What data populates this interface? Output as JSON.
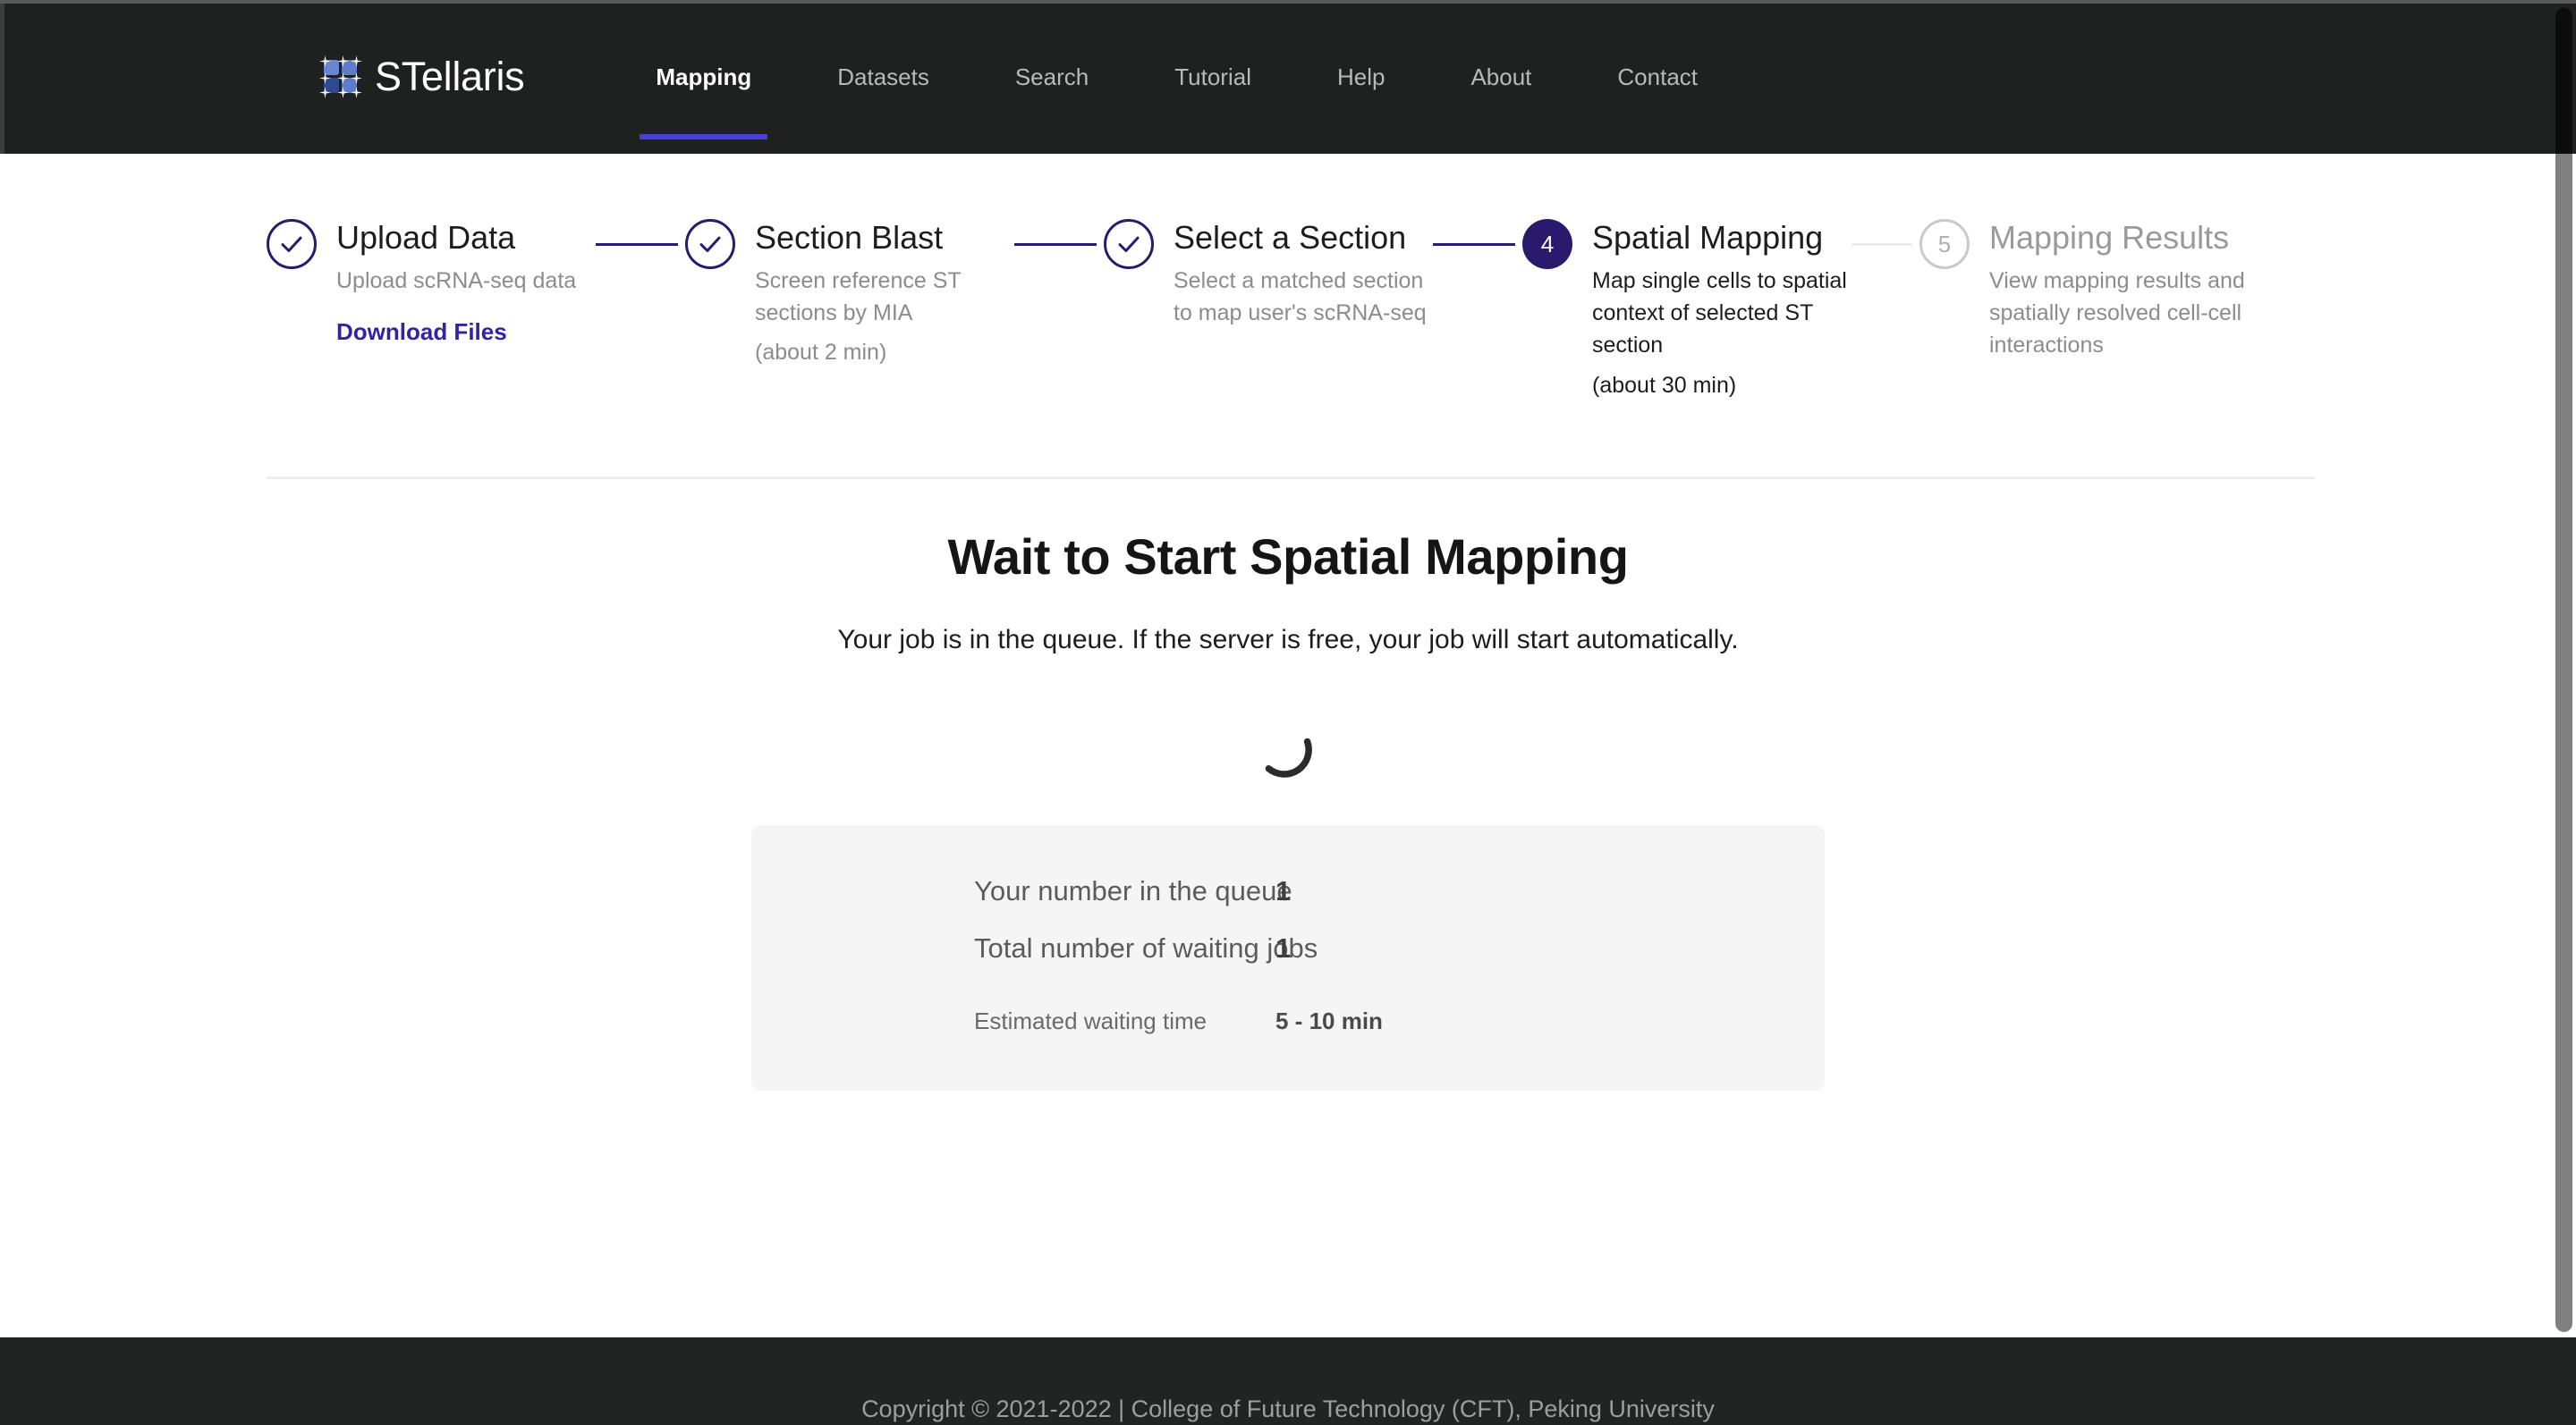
{
  "navbar": {
    "brand": "STellaris",
    "logo_icon": "stellaris-grid-logo-icon",
    "links": [
      {
        "label": "Mapping",
        "active": true
      },
      {
        "label": "Datasets",
        "active": false
      },
      {
        "label": "Search",
        "active": false
      },
      {
        "label": "Tutorial",
        "active": false
      },
      {
        "label": "Help",
        "active": false
      },
      {
        "label": "About",
        "active": false
      },
      {
        "label": "Contact",
        "active": false
      }
    ],
    "accent_underline_color": "#4a3fd8",
    "background_color": "#1f2020"
  },
  "stepper": {
    "accent_color": "#2a1a6e",
    "steps": [
      {
        "number": "1",
        "state": "done",
        "marker": "check-icon",
        "title": "Upload Data",
        "desc": "Upload scRNA-seq data",
        "time": "",
        "link": "Download Files"
      },
      {
        "number": "2",
        "state": "done",
        "marker": "check-icon",
        "title": "Section Blast",
        "desc": "Screen reference ST sections by MIA",
        "time": "(about 2 min)",
        "link": ""
      },
      {
        "number": "3",
        "state": "done",
        "marker": "check-icon",
        "title": "Select a Section",
        "desc": "Select a matched section to map user's scRNA-seq",
        "time": "",
        "link": ""
      },
      {
        "number": "4",
        "state": "current",
        "marker": "4",
        "title": "Spatial Mapping",
        "desc": "Map single cells to spatial context of selected ST section",
        "time": "(about 30 min)",
        "link": ""
      },
      {
        "number": "5",
        "state": "pending",
        "marker": "5",
        "title": "Mapping Results",
        "desc": "View mapping results and spatially resolved cell-cell interactions",
        "time": "",
        "link": ""
      }
    ]
  },
  "main": {
    "title": "Wait to Start Spatial Mapping",
    "subtitle": "Your job is in the queue. If the server is free, your job will start automatically.",
    "spinner_icon": "loading-spinner-icon",
    "info_card": {
      "rows": [
        {
          "label": "Your number in the queue",
          "value": "1"
        },
        {
          "label": "Total number of waiting jobs",
          "value": "1"
        },
        {
          "label": "Estimated waiting time",
          "value": "5 - 10 min"
        }
      ]
    }
  },
  "footer": {
    "text": "Copyright © 2021-2022 | College of Future Technology (CFT), Peking University"
  }
}
